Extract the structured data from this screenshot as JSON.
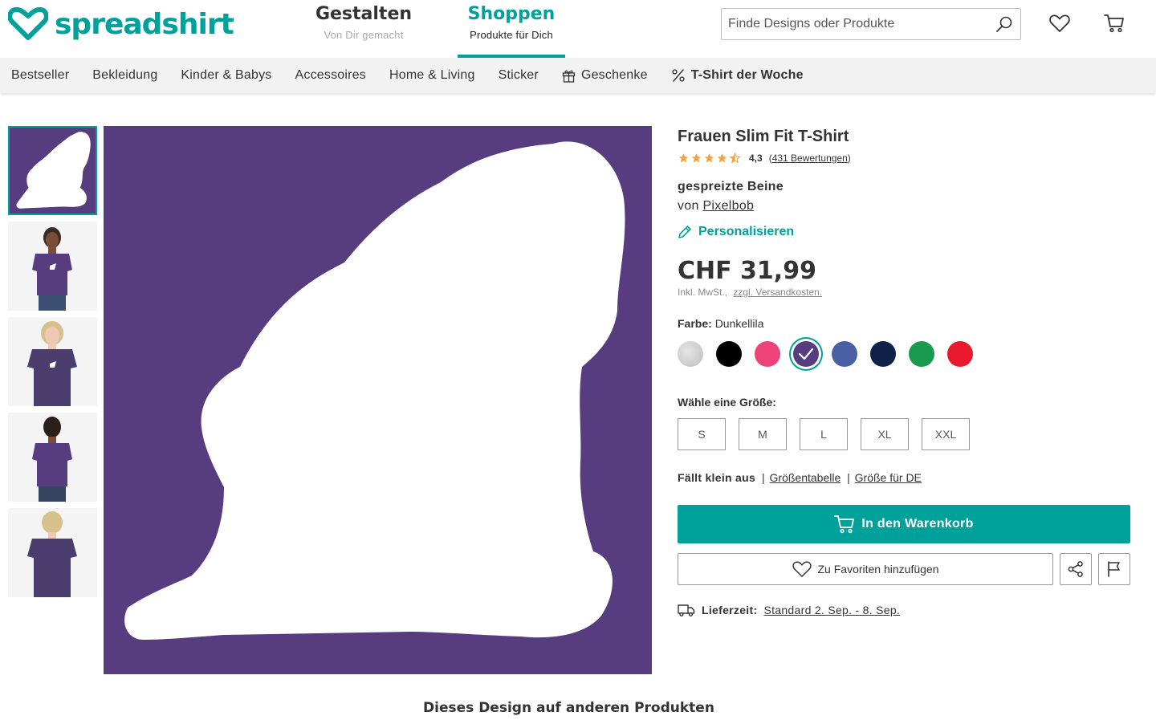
{
  "header": {
    "logo_text": "spreadshirt",
    "tabs": [
      {
        "title": "Gestalten",
        "subtitle": "Von Dir gemacht"
      },
      {
        "title": "Shoppen",
        "subtitle": "Produkte für Dich"
      }
    ],
    "search_placeholder": "Finde Designs oder Produkte"
  },
  "nav": {
    "items": [
      "Bestseller",
      "Bekleidung",
      "Kinder & Babys",
      "Accessoires",
      "Home & Living",
      "Sticker",
      "Geschenke",
      "T-Shirt der Woche"
    ]
  },
  "product": {
    "title": "Frauen Slim Fit T-Shirt",
    "rating_value": "4,3",
    "rating_stars": 4.3,
    "reviews_open": "(",
    "reviews_link": "431 Bewertungen",
    "reviews_close": ")",
    "design_name": "gespreizte Beine",
    "by_label": "von",
    "designer": "Pixelbob",
    "personalize": "Personalisieren",
    "price": "CHF 31,99",
    "tax_text": "Inkl. MwSt.,",
    "shipping_link": "zzgl. Versandkosten.",
    "color_label": "Farbe:",
    "color_value": "Dunkellila",
    "colors": [
      {
        "name": "Grau meliert",
        "hex": "#cfcfcf"
      },
      {
        "name": "Schwarz",
        "hex": "#000000"
      },
      {
        "name": "Azalea",
        "hex": "#ee4378"
      },
      {
        "name": "Dunkellila",
        "hex": "#573c80"
      },
      {
        "name": "Denim",
        "hex": "#4a5ea3"
      },
      {
        "name": "Navy",
        "hex": "#0f2148"
      },
      {
        "name": "Kelly Green",
        "hex": "#189a4f"
      },
      {
        "name": "Rot",
        "hex": "#e8192c"
      }
    ],
    "size_label": "Wähle eine Größe:",
    "sizes": [
      "S",
      "M",
      "L",
      "XL",
      "XXL"
    ],
    "fit_note": "Fällt klein aus",
    "fit_sep": "|",
    "size_chart_link": "Größentabelle",
    "size_de_link": "Größe für DE",
    "add_to_cart": "In den Warenkorb",
    "add_to_favorites": "Zu Favoriten hinzufügen",
    "delivery_label": "Lieferzeit:",
    "delivery_value": "Standard 2. Sep. - 8. Sep."
  },
  "section_title": "Dieses Design auf anderen Produkten",
  "colors": {
    "accent": "#00a19a",
    "shirt": "#573c80",
    "star": "#f2a33a"
  }
}
